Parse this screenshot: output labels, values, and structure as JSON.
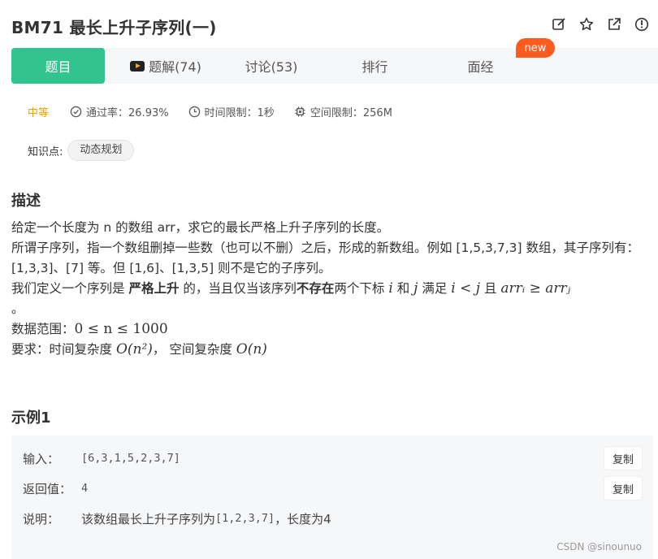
{
  "title": "BM71  最长上升子序列(一)",
  "header_icons": [
    "edit-icon",
    "star-icon",
    "share-icon",
    "info-icon"
  ],
  "tabs": [
    {
      "label": "题目",
      "active": true
    },
    {
      "label": "题解(74)",
      "icon": "video-icon"
    },
    {
      "label": "讨论(53)"
    },
    {
      "label": "排行"
    },
    {
      "label": "面经"
    }
  ],
  "new_badge": "new",
  "meta": {
    "difficulty": "中等",
    "pass_rate": "通过率：26.93%",
    "time_limit": "时间限制：1秒",
    "space_limit": "空间限制：256M"
  },
  "knowledge": {
    "label": "知识点:",
    "tag": "动态规划"
  },
  "description": {
    "heading": "描述",
    "line1": "给定一个长度为 n 的数组 arr，求它的最长严格上升子序列的长度。",
    "line2": "所谓子序列，指一个数组删掉一些数（也可以不删）之后，形成的新数组。例如 [1,5,3,7,3] 数组，其子序列有：[1,3,3]、[7] 等。但 [1,6]、[1,3,5] 则不是它的子序列。",
    "line3_a": "我们定义一个序列是 ",
    "line3_b": "严格上升",
    "line3_c": " 的，当且仅当该序列",
    "line3_d": "不存在",
    "line3_e": "两个下标 ",
    "line3_i": "i",
    "line3_f": " 和 ",
    "line3_j": "j",
    "line3_g": " 满足 ",
    "line3_cond": "i < j",
    "line3_h": " 且 ",
    "line3_expr": "arrᵢ ≥ arrⱼ",
    "line4": "。",
    "range_label": "数据范围：",
    "range_math": "0 ≤ n ≤ 1000",
    "req_label": "要求：时间复杂度 ",
    "req_time": "O(n²)",
    "req_mid": "，  空间复杂度 ",
    "req_space": "O(n)"
  },
  "example": {
    "heading": "示例1",
    "input_label": "输入：",
    "input_value": "[6,3,1,5,2,3,7]",
    "output_label": "返回值：",
    "output_value": "4",
    "explain_label": "说明：",
    "explain_a": "该数组最长上升子序列为 ",
    "explain_code": "[1,2,3,7]",
    "explain_b": " ，长度为4",
    "copy_label": "复制"
  },
  "watermark": "CSDN @sinounuo"
}
